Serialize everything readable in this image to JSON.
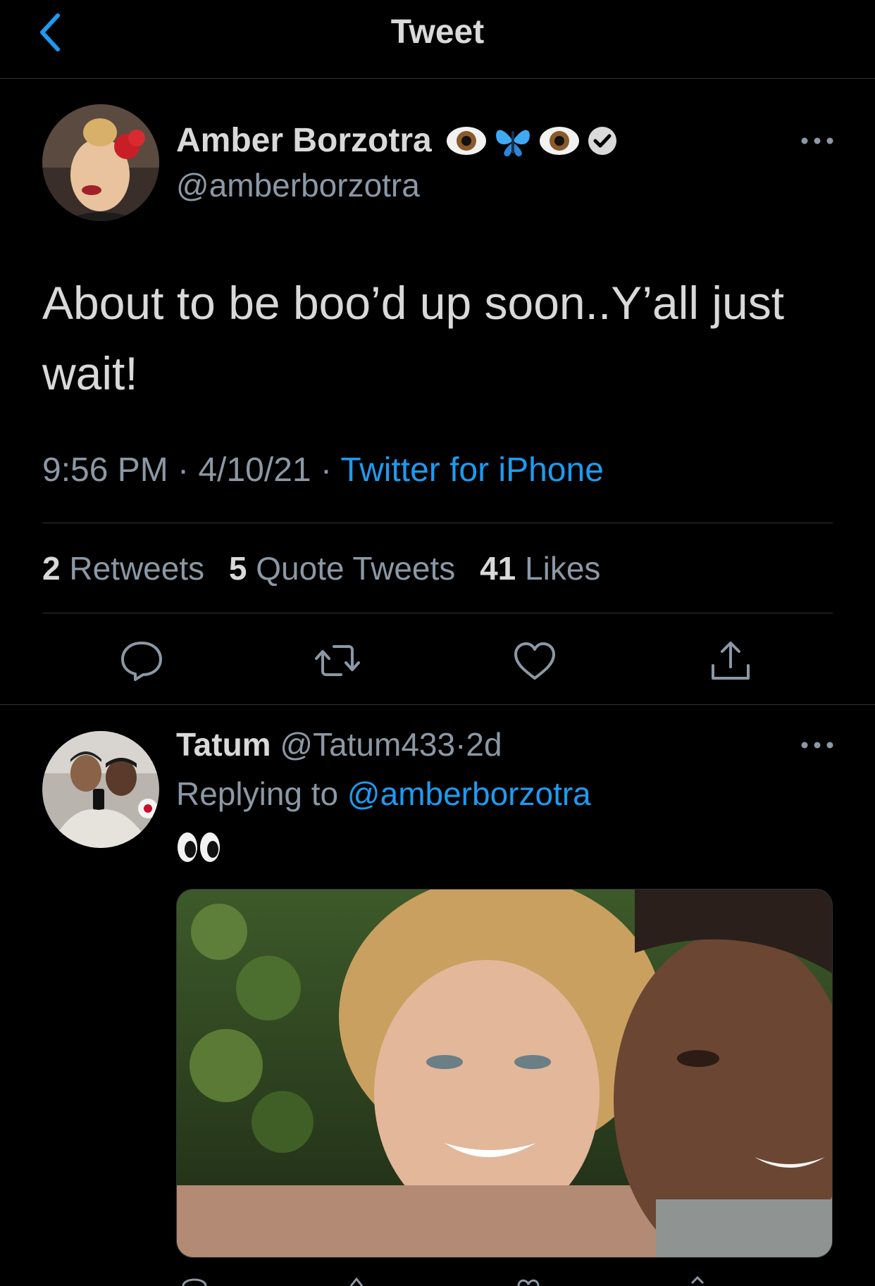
{
  "header": {
    "title": "Tweet"
  },
  "tweet": {
    "author_name": "Amber Borzotra",
    "author_handle": "@amberborzotra",
    "text": "About to be boo’d up soon..Y’all just wait!",
    "time": "9:56 PM",
    "date": "4/10/21",
    "source": "Twitter for iPhone",
    "separator": "·",
    "stats": {
      "retweets_count": "2",
      "retweets_label": "Retweets",
      "quotes_count": "5",
      "quotes_label": "Quote Tweets",
      "likes_count": "41",
      "likes_label": "Likes"
    }
  },
  "reply": {
    "author_name": "Tatum",
    "author_handle": "@Tatum433",
    "age": "2d",
    "replying_to_label": "Replying to",
    "replying_to_handle": "@amberborzotra",
    "text": "👀"
  },
  "colors": {
    "background": "#000000",
    "accent": "#1d9bf0",
    "muted": "#8b98a5",
    "divider": "#2f3336"
  },
  "icons": [
    "back-chevron-icon",
    "eye-emoji-icon",
    "butterfly-emoji-icon",
    "verified-badge-icon",
    "more-options-icon",
    "reply-icon",
    "retweet-icon",
    "like-icon",
    "share-icon"
  ]
}
